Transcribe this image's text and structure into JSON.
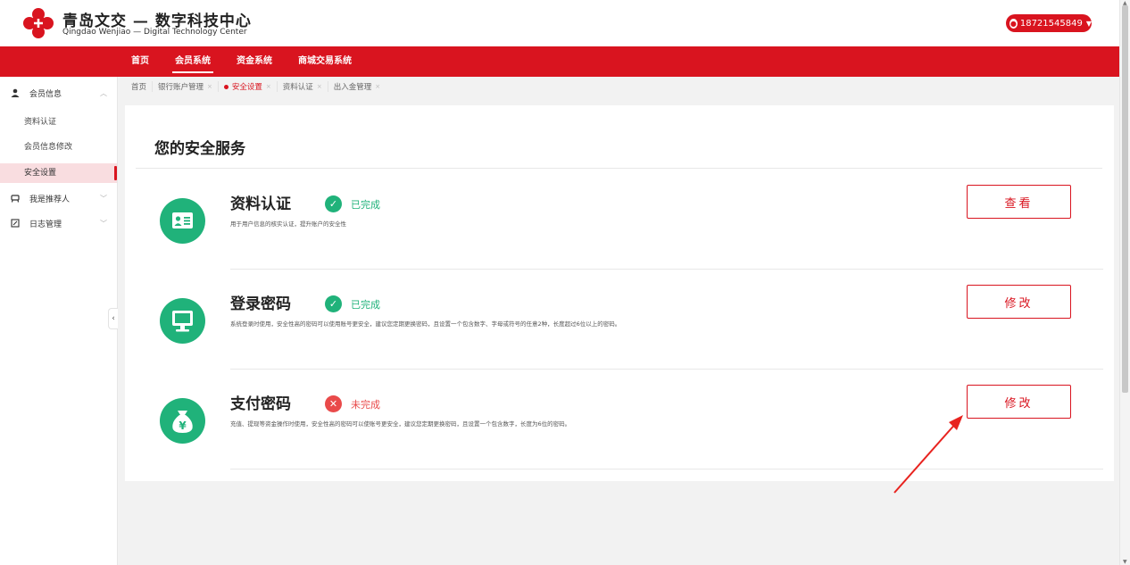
{
  "header": {
    "logo_cn": "青岛文交 — 数字科技中心",
    "logo_en": "Qingdao Wenjiao — Digital Technology Center",
    "user_phone": "18721545849"
  },
  "nav": {
    "items": [
      "首页",
      "会员系统",
      "资金系统",
      "商城交易系统"
    ],
    "active": "会员系统"
  },
  "sidebar": {
    "groups": [
      {
        "label": "会员信息",
        "icon": "person-icon",
        "children": [
          "资料认证",
          "会员信息修改",
          "安全设置"
        ]
      },
      {
        "label": "我是推荐人",
        "icon": "recommend-icon"
      },
      {
        "label": "日志管理",
        "icon": "log-icon"
      }
    ],
    "active_item": "安全设置"
  },
  "tabs": [
    {
      "label": "首页"
    },
    {
      "label": "银行账户管理"
    },
    {
      "label": "安全设置"
    },
    {
      "label": "资料认证"
    },
    {
      "label": "出入金管理"
    }
  ],
  "page": {
    "title": "您的安全服务",
    "items": [
      {
        "name": "资料认证",
        "status": "已完成",
        "done": true,
        "desc": "用于用户信息的核实认证，提升账户的安全性",
        "button": "查看",
        "icon": "id-card-icon"
      },
      {
        "name": "登录密码",
        "status": "已完成",
        "done": true,
        "desc": "系统登录时使用，安全性高的密码可以使用账号更安全，建议您定期更换密码，且设置一个包含数字、字母或符号的任意2种，长度超过6位以上的密码。",
        "button": "修改",
        "icon": "monitor-icon"
      },
      {
        "name": "支付密码",
        "status": "未完成",
        "done": false,
        "desc": "充值、提现等资金操作时使用，安全性高的密码可以使账号更安全，建议您定期更换密码，且设置一个包含数字，长度为6位的密码。",
        "button": "修改",
        "icon": "money-bag-icon"
      }
    ]
  },
  "colors": {
    "brand_red": "#d9141f",
    "success_green": "#20b27a",
    "error_red": "#e94a4a",
    "annotation_arrow": "#e8231f"
  }
}
